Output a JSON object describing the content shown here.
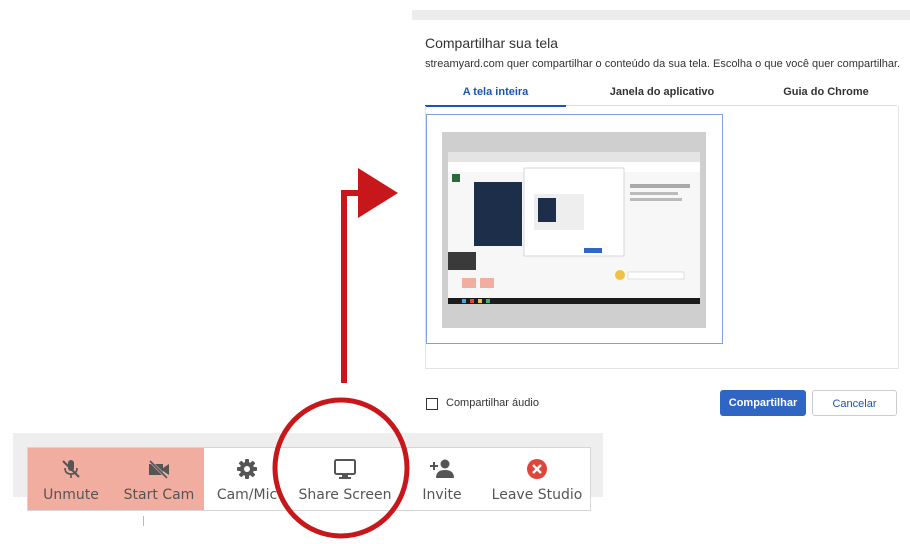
{
  "dialog": {
    "title": "Compartilhar sua tela",
    "subtitle": "streamyard.com quer compartilhar o conteúdo da sua tela. Escolha o que você quer compartilhar.",
    "tabs": [
      {
        "label": "A tela inteira",
        "active": true
      },
      {
        "label": "Janela do aplicativo",
        "active": false
      },
      {
        "label": "Guia do Chrome",
        "active": false
      }
    ],
    "share_audio_label": "Compartilhar áudio",
    "share_audio_checked": false,
    "share_button": "Compartilhar",
    "cancel_button": "Cancelar"
  },
  "toolbar": {
    "buttons": [
      {
        "label": "Unmute",
        "icon": "mic-off-icon",
        "active": true
      },
      {
        "label": "Start Cam",
        "icon": "camera-off-icon",
        "active": true
      },
      {
        "label": "Cam/Mic",
        "icon": "gear-icon",
        "active": false
      },
      {
        "label": "Share Screen",
        "icon": "monitor-icon",
        "active": false
      },
      {
        "label": "Invite",
        "icon": "add-person-icon",
        "active": false
      },
      {
        "label": "Leave Studio",
        "icon": "close-circle-icon",
        "active": false
      }
    ]
  },
  "colors": {
    "accent": "#2f66c4",
    "annotation_red": "#c8171b",
    "active_button_bg": "#f1ada0",
    "leave_icon": "#e0453a"
  }
}
